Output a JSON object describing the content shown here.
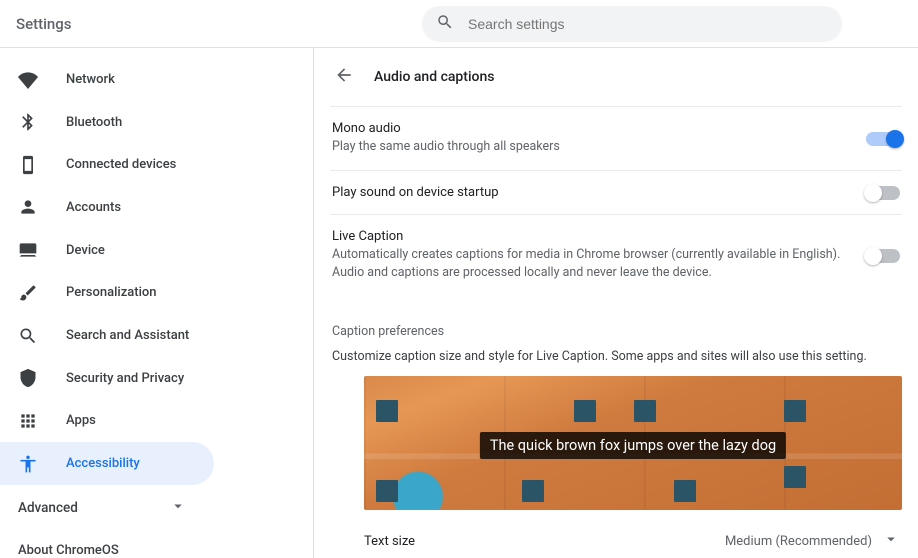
{
  "app_title": "Settings",
  "search": {
    "placeholder": "Search settings"
  },
  "sidebar": {
    "items": [
      {
        "label": "Network"
      },
      {
        "label": "Bluetooth"
      },
      {
        "label": "Connected devices"
      },
      {
        "label": "Accounts"
      },
      {
        "label": "Device"
      },
      {
        "label": "Personalization"
      },
      {
        "label": "Search and Assistant"
      },
      {
        "label": "Security and Privacy"
      },
      {
        "label": "Apps"
      },
      {
        "label": "Accessibility"
      }
    ],
    "advanced_label": "Advanced",
    "about_label": "About ChromeOS"
  },
  "page": {
    "title": "Audio and captions",
    "mono": {
      "title": "Mono audio",
      "desc": "Play the same audio through all speakers",
      "on": true
    },
    "startup_sound": {
      "title": "Play sound on device startup",
      "on": false
    },
    "live_caption": {
      "title": "Live Caption",
      "desc": "Automatically creates captions for media in Chrome browser (currently available in English). Audio and captions are processed locally and never leave the device.",
      "on": false
    },
    "caption_prefs": {
      "heading": "Caption preferences",
      "desc": "Customize caption size and style for Live Caption. Some apps and sites will also use this setting.",
      "sample_text": "The quick brown fox jumps over the lazy dog"
    },
    "text_size": {
      "label": "Text size",
      "value": "Medium (Recommended)"
    }
  }
}
